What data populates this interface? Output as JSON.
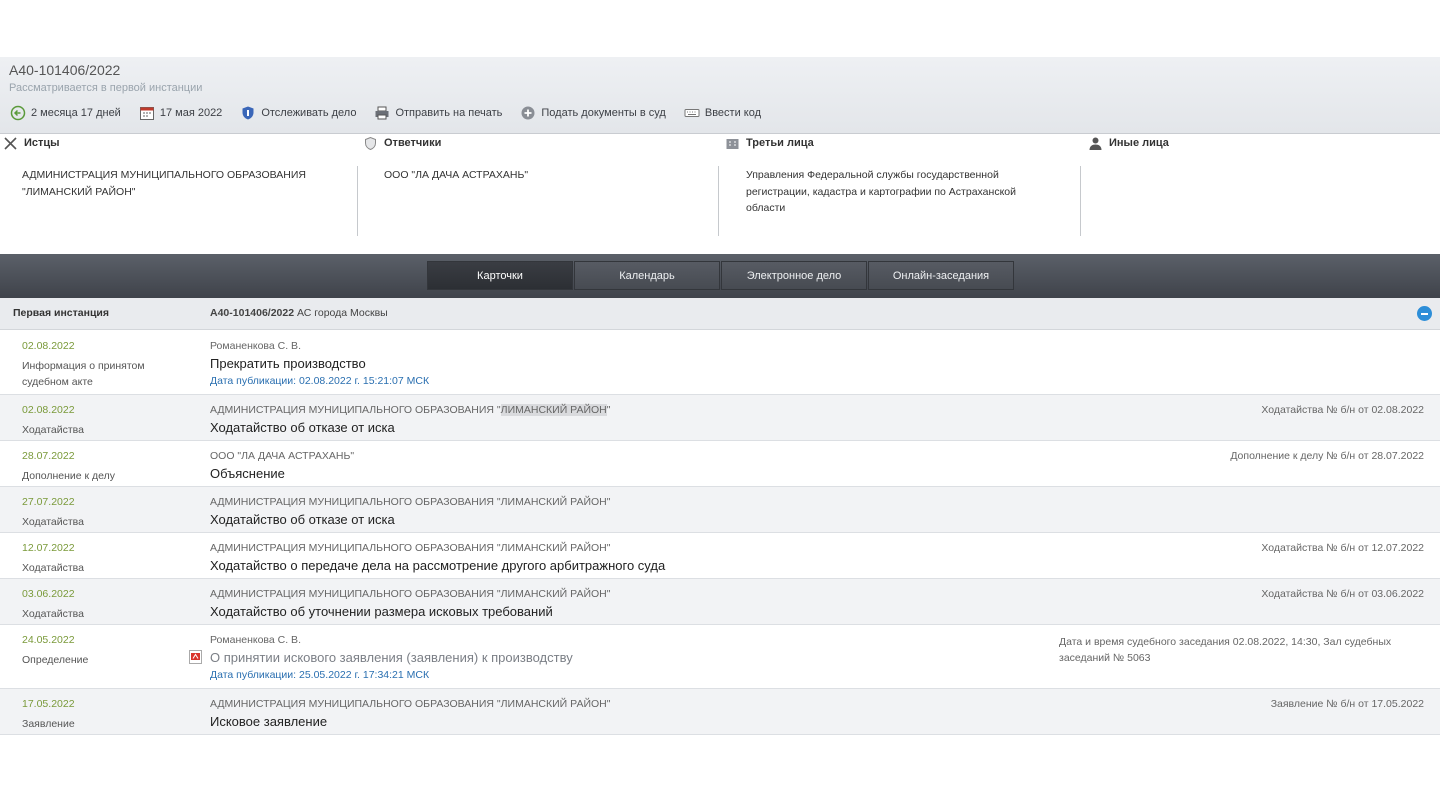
{
  "header": {
    "case_number": "А40-101406/2022",
    "status": "Рассматривается в первой инстанции",
    "toolbar": [
      {
        "icon": "back-arrow-icon",
        "label": "2 месяца 17 дней"
      },
      {
        "icon": "calendar-icon",
        "label": "17 мая 2022"
      },
      {
        "icon": "shield-icon",
        "label": "Отслеживать дело"
      },
      {
        "icon": "printer-icon",
        "label": "Отправить на печать"
      },
      {
        "icon": "plus-circle-icon",
        "label": "Подать документы в суд"
      },
      {
        "icon": "keyboard-icon",
        "label": "Ввести код"
      }
    ]
  },
  "parties": {
    "plaintiffs": {
      "label": "Истцы",
      "icon": "swords-icon",
      "names": [
        "АДМИНИСТРАЦИЯ МУНИЦИПАЛЬНОГО ОБРАЗОВАНИЯ \"ЛИМАНСКИЙ РАЙОН\""
      ]
    },
    "defendants": {
      "label": "Ответчики",
      "icon": "shield-icon",
      "names": [
        "ООО \"ЛА ДАЧА АСТРАХАНЬ\""
      ]
    },
    "third_parties": {
      "label": "Третьи лица",
      "icon": "building-icon",
      "names": [
        "Управления Федеральной службы государственной регистрации, кадастра и картографии по Астраханской области"
      ]
    },
    "others": {
      "label": "Иные лица",
      "icon": "person-icon",
      "names": []
    }
  },
  "tabs": [
    "Карточки",
    "Календарь",
    "Электронное дело",
    "Онлайн-заседания"
  ],
  "active_tab": 0,
  "instance": {
    "title": "Первая инстанция",
    "case_number": "А40-101406/2022",
    "court": "АС города Москвы"
  },
  "events": [
    {
      "date": "02.08.2022",
      "type": "Информация о принятом судебном акте",
      "author": "Романенкова С. В.",
      "title": "Прекратить производство",
      "pub": "Дата публикации: 02.08.2022 г. 15:21:07 МСК",
      "right": ""
    },
    {
      "date": "02.08.2022",
      "type": "Ходатайства",
      "author_pre": "АДМИНИСТРАЦИЯ МУНИЦИПАЛЬНОГО ОБРАЗОВАНИЯ \"",
      "author_hl": "ЛИМАНСКИЙ РАЙОН",
      "author_post": "\"",
      "title": "Ходатайство об отказе от иска",
      "right": "Ходатайства № б/н от 02.08.2022"
    },
    {
      "date": "28.07.2022",
      "type": "Дополнение к делу",
      "author": "ООО \"ЛА ДАЧА АСТРАХАНЬ\"",
      "title": "Объяснение",
      "right": "Дополнение к делу № б/н от 28.07.2022"
    },
    {
      "date": "27.07.2022",
      "type": "Ходатайства",
      "author": "АДМИНИСТРАЦИЯ МУНИЦИПАЛЬНОГО ОБРАЗОВАНИЯ \"ЛИМАНСКИЙ РАЙОН\"",
      "title": "Ходатайство об отказе от иска",
      "right": ""
    },
    {
      "date": "12.07.2022",
      "type": "Ходатайства",
      "author": "АДМИНИСТРАЦИЯ МУНИЦИПАЛЬНОГО ОБРАЗОВАНИЯ \"ЛИМАНСКИЙ РАЙОН\"",
      "title": "Ходатайство о передаче дела на рассмотрение другого арбитражного суда",
      "right": "Ходатайства № б/н от 12.07.2022"
    },
    {
      "date": "03.06.2022",
      "type": "Ходатайства",
      "author": "АДМИНИСТРАЦИЯ МУНИЦИПАЛЬНОГО ОБРАЗОВАНИЯ \"ЛИМАНСКИЙ РАЙОН\"",
      "title": "Ходатайство об уточнении размера исковых требований",
      "right": "Ходатайства № б/н от 03.06.2022"
    },
    {
      "date": "24.05.2022",
      "type": "Определение",
      "author": "Романенкова С. В.",
      "title": "О принятии искового заявления (заявления) к производству",
      "pub": "Дата публикации: 25.05.2022 г. 17:34:21 МСК",
      "right": "Дата и время судебного заседания 02.08.2022, 14:30, Зал судебных заседаний № 5063"
    },
    {
      "date": "17.05.2022",
      "type": "Заявление",
      "author": "АДМИНИСТРАЦИЯ МУНИЦИПАЛЬНОГО ОБРАЗОВАНИЯ \"ЛИМАНСКИЙ РАЙОН\"",
      "title": "Исковое заявление",
      "right": "Заявление № б/н от 17.05.2022"
    }
  ],
  "colors": {
    "date": "#7a9a3a",
    "link": "#2a6fb0",
    "tabbar": "#4a4e55",
    "collapse": "#2d8ed8"
  }
}
